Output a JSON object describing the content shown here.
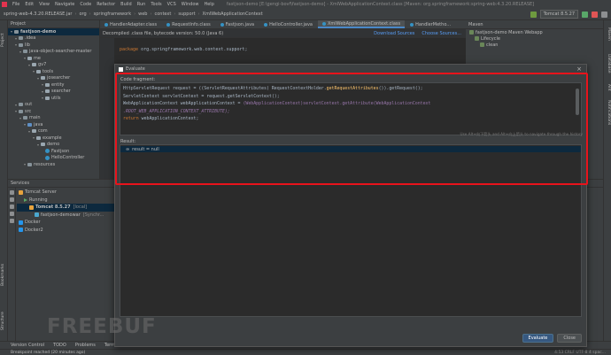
{
  "menubar": {
    "items": [
      "File",
      "Edit",
      "View",
      "Navigate",
      "Code",
      "Refactor",
      "Build",
      "Run",
      "Tools",
      "VCS",
      "Window",
      "Help"
    ],
    "window_title": "fastjson-demo [E:\\gengi-bovf\\fastjson-demo] - XmlWebApplicationContext.class [Maven: org.springframework:spring-web:4.3.20.RELEASE]"
  },
  "navbar": {
    "crumbs": [
      "spring-web-4.3.20.RELEASE.jar",
      "org",
      "springframework",
      "web",
      "context",
      "support",
      "XmlWebApplicationContext"
    ],
    "run_config": "Tomcat 8.5.27"
  },
  "left_strip": {
    "project": "Project",
    "structure": "Structure",
    "bookmarks": "Bookmarks"
  },
  "right_strip": {
    "maven": "Maven",
    "database": "Database",
    "ant": "Ant",
    "notifications": "Notifications"
  },
  "project_panel": {
    "header": "Project",
    "rows": [
      {
        "indent": 0,
        "label": "fastjson-demo",
        "kind": "folder",
        "bold": true
      },
      {
        "indent": 1,
        "label": ".idea",
        "kind": "folder"
      },
      {
        "indent": 1,
        "label": "lib",
        "kind": "folder"
      },
      {
        "indent": 2,
        "label": "java-object-searcher-master",
        "kind": "folder"
      },
      {
        "indent": 3,
        "label": "me",
        "kind": "pkg"
      },
      {
        "indent": 4,
        "label": "gv7",
        "kind": "pkg"
      },
      {
        "indent": 5,
        "label": "tools",
        "kind": "pkg"
      },
      {
        "indent": 6,
        "label": "josearcher",
        "kind": "pkg"
      },
      {
        "indent": 7,
        "label": "entity",
        "kind": "pkg"
      },
      {
        "indent": 7,
        "label": "searcher",
        "kind": "pkg"
      },
      {
        "indent": 7,
        "label": "utils",
        "kind": "pkg"
      },
      {
        "indent": 1,
        "label": "out",
        "kind": "folder"
      },
      {
        "indent": 1,
        "label": "src",
        "kind": "folder"
      },
      {
        "indent": 2,
        "label": "main",
        "kind": "folder"
      },
      {
        "indent": 3,
        "label": "java",
        "kind": "src"
      },
      {
        "indent": 4,
        "label": "com",
        "kind": "pkg"
      },
      {
        "indent": 5,
        "label": "example",
        "kind": "pkg"
      },
      {
        "indent": 6,
        "label": "demo",
        "kind": "pkg"
      },
      {
        "indent": 7,
        "label": "Fastjson",
        "kind": "class"
      },
      {
        "indent": 7,
        "label": "HelloController",
        "kind": "class"
      },
      {
        "indent": 3,
        "label": "resources",
        "kind": "folder"
      }
    ]
  },
  "editor_tabs": [
    {
      "label": "HandlerAdapter.class",
      "active": false
    },
    {
      "label": "RequestInfo.class",
      "active": false
    },
    {
      "label": "Fastjson.java",
      "active": false
    },
    {
      "label": "HelloController.java",
      "active": false
    },
    {
      "label": "XmlWebApplicationContext.class",
      "active": true
    },
    {
      "label": "HandlerMetho...",
      "active": false
    }
  ],
  "decompiled_bar": {
    "text": "Decompiled .class file, bytecode version: 50.0 (Java 6)",
    "download": "Download Sources",
    "choose": "Choose Sources..."
  },
  "editor_code": {
    "keyword": "package",
    "rest": "org.springframework.web.context.support;"
  },
  "maven_panel": {
    "header": "Maven",
    "rows": [
      {
        "indent": 0,
        "label": "fastjson-demo Maven Webapp"
      },
      {
        "indent": 1,
        "label": "Lifecycle"
      },
      {
        "indent": 2,
        "label": "clean"
      }
    ]
  },
  "services_panel": {
    "header": "Services",
    "rows": [
      {
        "indent": 0,
        "label": "Tomcat Server",
        "icon": "tomcat"
      },
      {
        "indent": 1,
        "label": "Running",
        "icon": "run"
      },
      {
        "indent": 2,
        "label": "Tomcat 8.5.27",
        "suffix": "[local]",
        "icon": "tomcat",
        "bold": true,
        "sel": true
      },
      {
        "indent": 3,
        "label": "fastjson-demowar",
        "suffix": "[Synchr...",
        "icon": "war"
      },
      {
        "indent": 0,
        "label": "Docker",
        "icon": "docker"
      },
      {
        "indent": 0,
        "label": "Docker2",
        "icon": "docker"
      }
    ]
  },
  "bottom_tabs": [
    "Version Control",
    "TODO",
    "Problems",
    "Terminal",
    "Profiler",
    "Services",
    "Build",
    "Spring"
  ],
  "status": {
    "left": "Breakpoint reached (20 minutes ago)",
    "right": "4:53   CRLF   UTF-8   4 spac..."
  },
  "dialog": {
    "title": "Evaluate",
    "close": "×",
    "fragment_label": "Code fragment:",
    "code_lines": [
      [
        {
          "t": "t",
          "s": "HttpServletRequest request = ((ServletRequestAttributes) RequestContextHolder."
        },
        {
          "t": "m",
          "s": "getRequestAttributes"
        },
        {
          "t": "t",
          "s": "()).getRequest();"
        }
      ],
      [
        {
          "t": "t",
          "s": "ServletContext servletContext = request.getServletContext();"
        }
      ],
      [
        {
          "t": "t",
          "s": "WebApplicationContext webApplicationContext = "
        },
        {
          "t": "p",
          "s": "(WebApplicationContext)servletContext.getAttribute(WebApplicationContext"
        }
      ],
      [
        {
          "t": "c",
          "s": "    .ROOT_WEB_APPLICATION_CONTEXT_ATTRIBUTE);"
        }
      ],
      [
        {
          "t": "k",
          "s": "return "
        },
        {
          "t": "t",
          "s": "webApplicationContext;"
        }
      ]
    ],
    "hint": "Use Alt+向下箭头 and Alt+向上箭头 to navigate through the history",
    "result_label": "Result:",
    "result_text": "result = null",
    "evaluate_btn": "Evaluate",
    "close_btn": "Close"
  },
  "watermark": "FREEBUF",
  "colors": {
    "highlight": "#e8131b",
    "selection": "#0d293e",
    "primary_button": "#365880"
  }
}
